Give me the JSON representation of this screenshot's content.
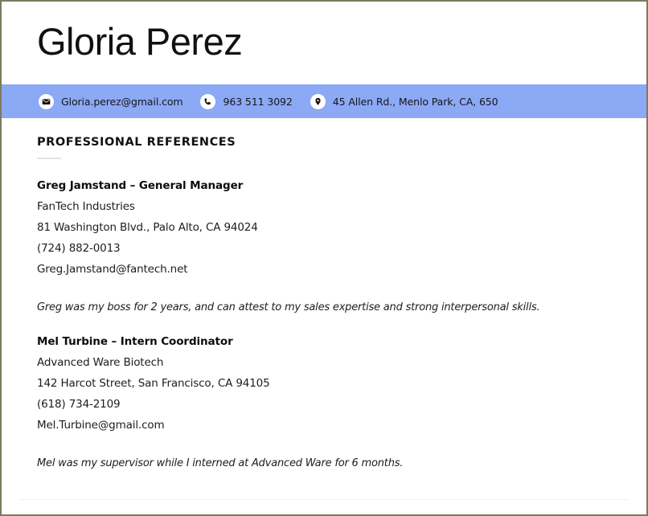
{
  "document": {
    "candidate_name": "Gloria Perez",
    "accent_color": "#8ca9f5",
    "border_color": "#7c7a5e"
  },
  "contact": {
    "items": [
      {
        "icon": "envelope-icon",
        "text": "Gloria.perez@gmail.com"
      },
      {
        "icon": "phone-icon",
        "text": "963 511 3092"
      },
      {
        "icon": "location-pin-icon",
        "text": "45 Allen Rd., Menlo Park, CA, 650"
      }
    ]
  },
  "section": {
    "title": "PROFESSIONAL REFERENCES"
  },
  "references": [
    {
      "name_title": "Greg Jamstand – General Manager",
      "company": "FanTech Industries",
      "address": "81 Washington Blvd., Palo Alto, CA 94024",
      "phone": "(724) 882-0013",
      "email": "Greg.Jamstand@fantech.net",
      "quote": "Greg was my boss for 2 years, and can attest to my sales expertise and strong interpersonal skills."
    },
    {
      "name_title": "Mel Turbine – Intern Coordinator",
      "company": "Advanced Ware Biotech",
      "address": "142 Harcot Street, San Francisco, CA 94105",
      "phone": "(618) 734-2109",
      "email": "Mel.Turbine@gmail.com",
      "quote": "Mel was my supervisor while I interned at Advanced Ware for 6 months."
    }
  ]
}
